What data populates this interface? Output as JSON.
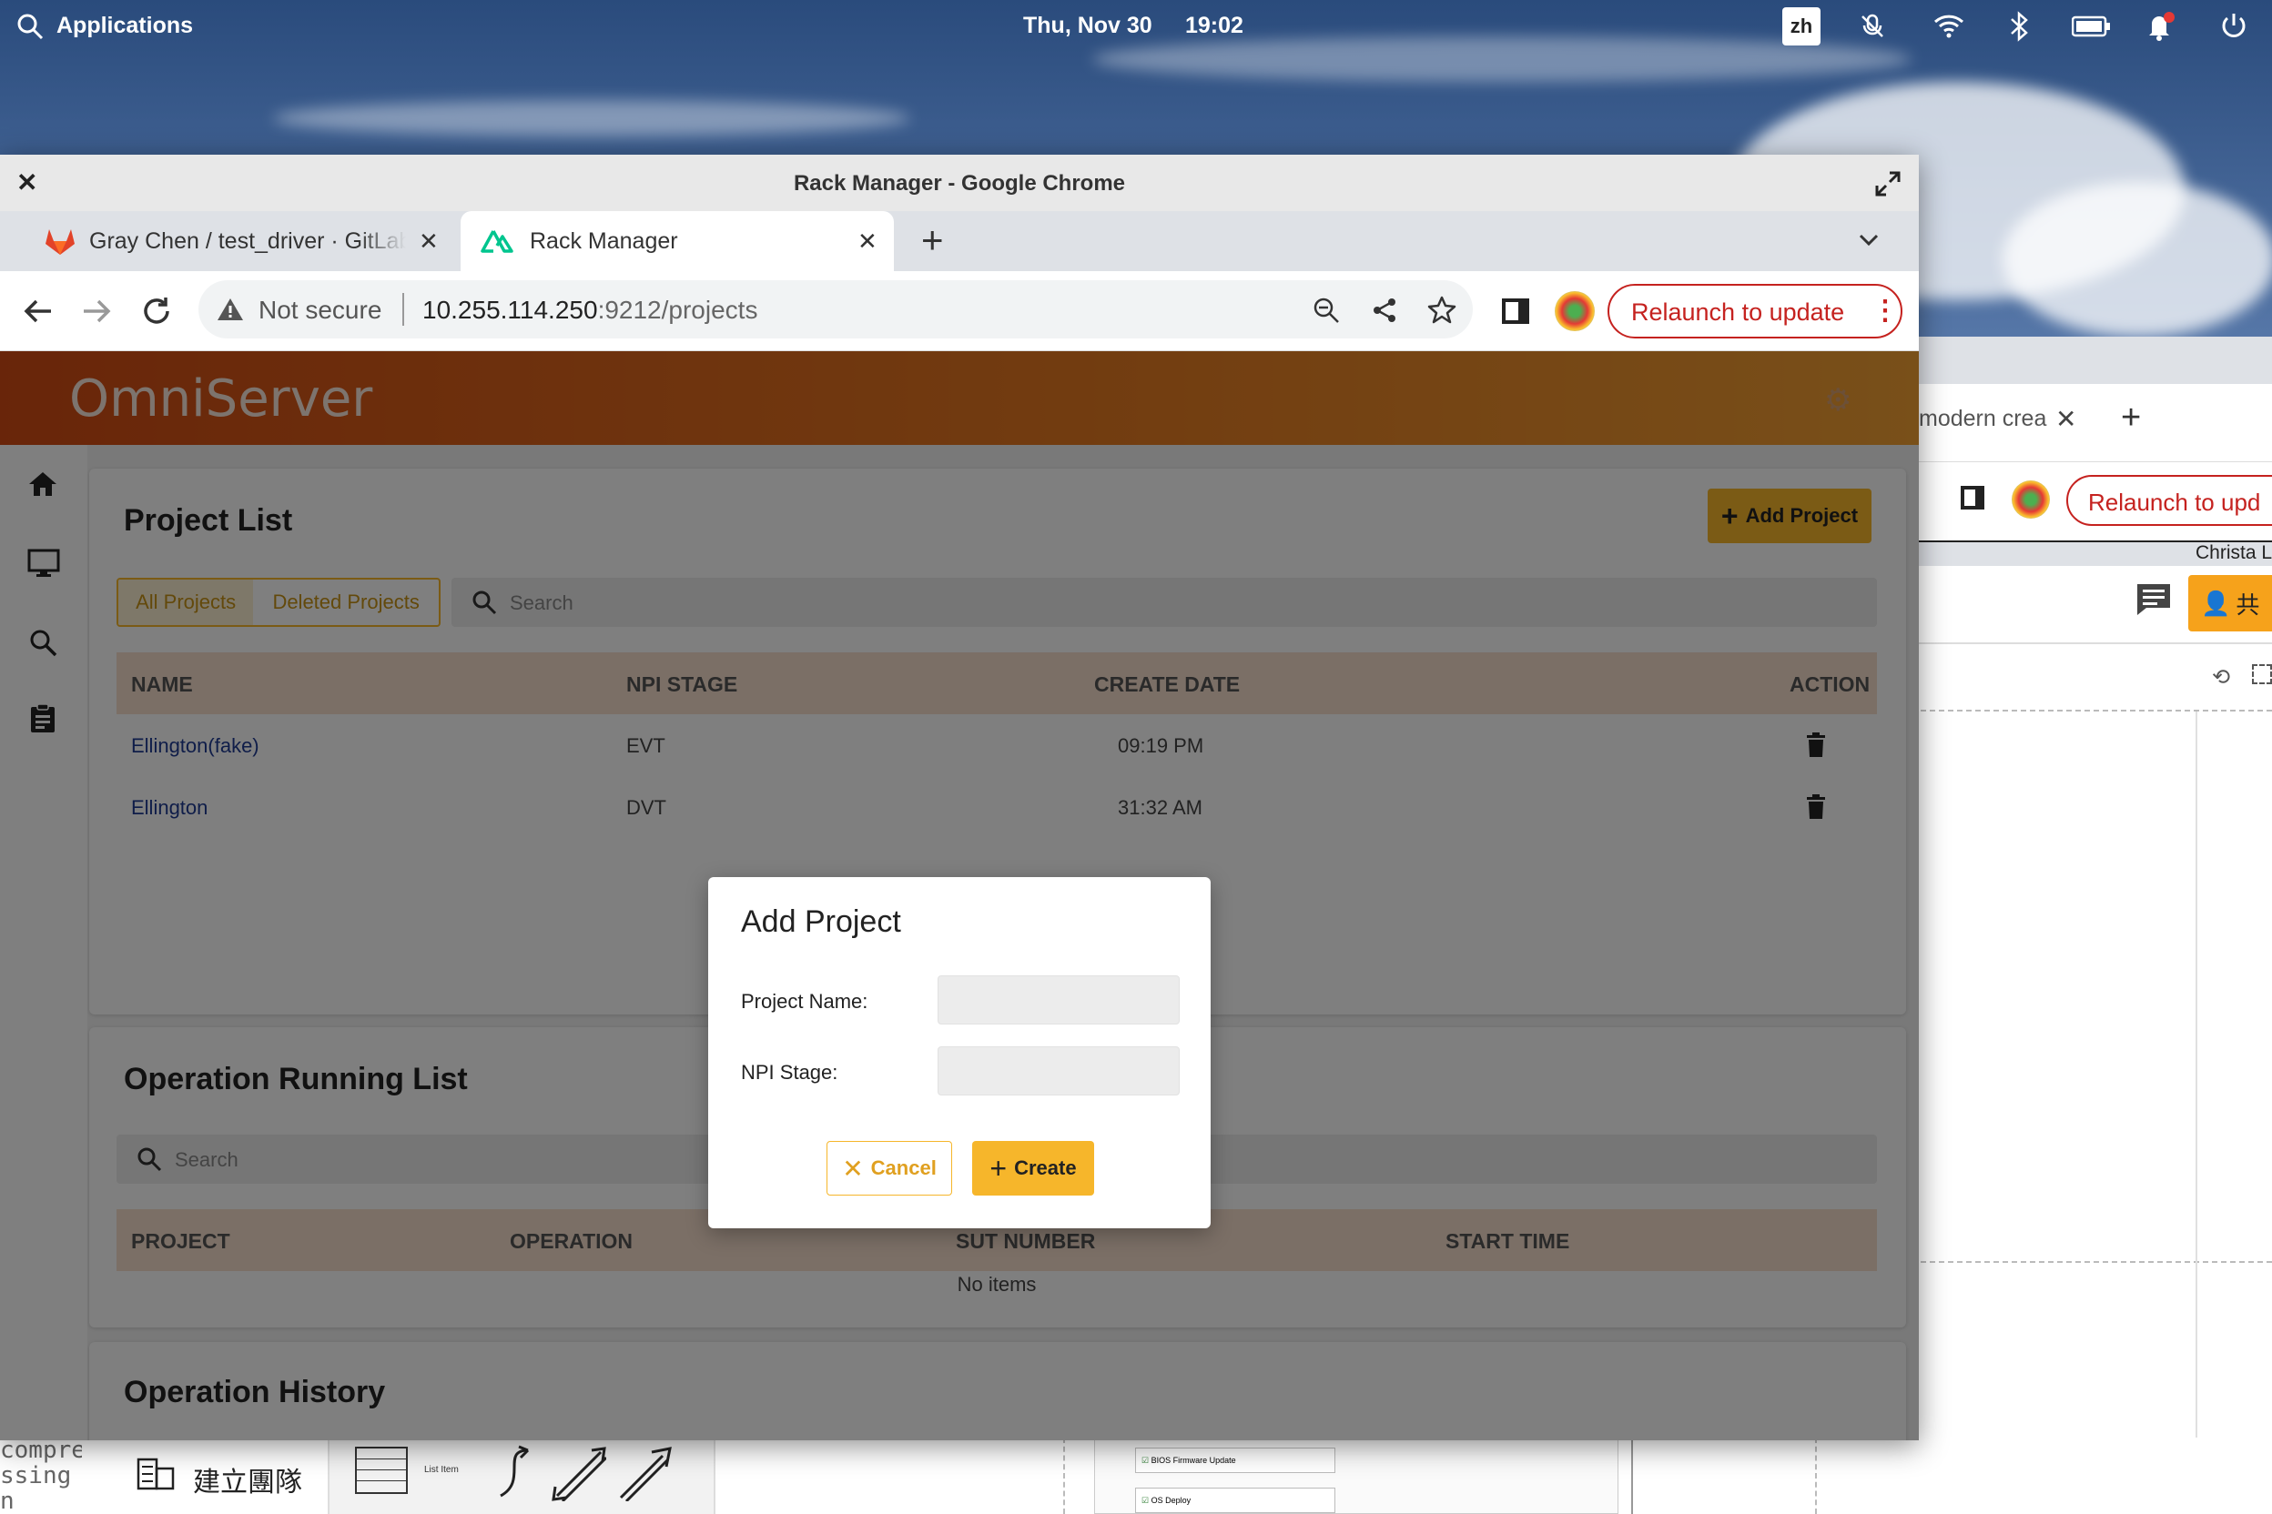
{
  "desktop": {
    "topbar": {
      "applications": "Applications",
      "date": "Thu, Nov 30",
      "time": "19:02",
      "input_method": "zh"
    }
  },
  "chrome": {
    "window_title": "Rack Manager - Google Chrome",
    "tabs": [
      {
        "label": "Gray Chen / test_driver · GitLab",
        "active": false
      },
      {
        "label": "Rack Manager",
        "active": true
      }
    ],
    "security_label": "Not secure",
    "url_host": "10.255.114.250",
    "url_path": ":9212/projects",
    "relaunch_label": "Relaunch to update"
  },
  "back_window": {
    "tab_label": "modern crea",
    "relaunch_label": "Relaunch to upd",
    "user_label": "Christa L",
    "share_label": "共"
  },
  "bottom_strip": {
    "terminal_lines": [
      "compre",
      "ssing",
      "n obje"
    ],
    "team_label": "建立團隊",
    "list_item_label": "List Item",
    "checklist": [
      "BIOS Firmware Update",
      "OS Deploy"
    ]
  },
  "app": {
    "brand": "OmniServer",
    "project_list": {
      "title": "Project List",
      "add_button": "Add Project",
      "filters": [
        "All Projects",
        "Deleted Projects"
      ],
      "search_placeholder": "Search",
      "columns": [
        "NAME",
        "NPI STAGE",
        "CREATE DATE",
        "ACTION"
      ],
      "rows": [
        {
          "name": "Ellington(fake)",
          "stage": "EVT",
          "date": "09:19 PM"
        },
        {
          "name": "Ellington",
          "stage": "DVT",
          "date": "31:32 AM"
        }
      ]
    },
    "running_list": {
      "title": "Operation Running List",
      "search_placeholder": "Search",
      "columns": [
        "PROJECT",
        "OPERATION",
        "SUT NUMBER",
        "START TIME"
      ],
      "empty": "No items"
    },
    "history": {
      "title": "Operation History"
    }
  },
  "modal": {
    "title": "Add Project",
    "project_name_label": "Project Name:",
    "npi_stage_label": "NPI Stage:",
    "project_name_value": "",
    "npi_stage_value": "",
    "cancel_label": "Cancel",
    "create_label": "Create"
  },
  "colors": {
    "accent": "#f6b62b",
    "relaunch": "#c5221f",
    "header_start": "#d24b14",
    "header_end": "#f2a033",
    "link": "#1f3a93"
  }
}
